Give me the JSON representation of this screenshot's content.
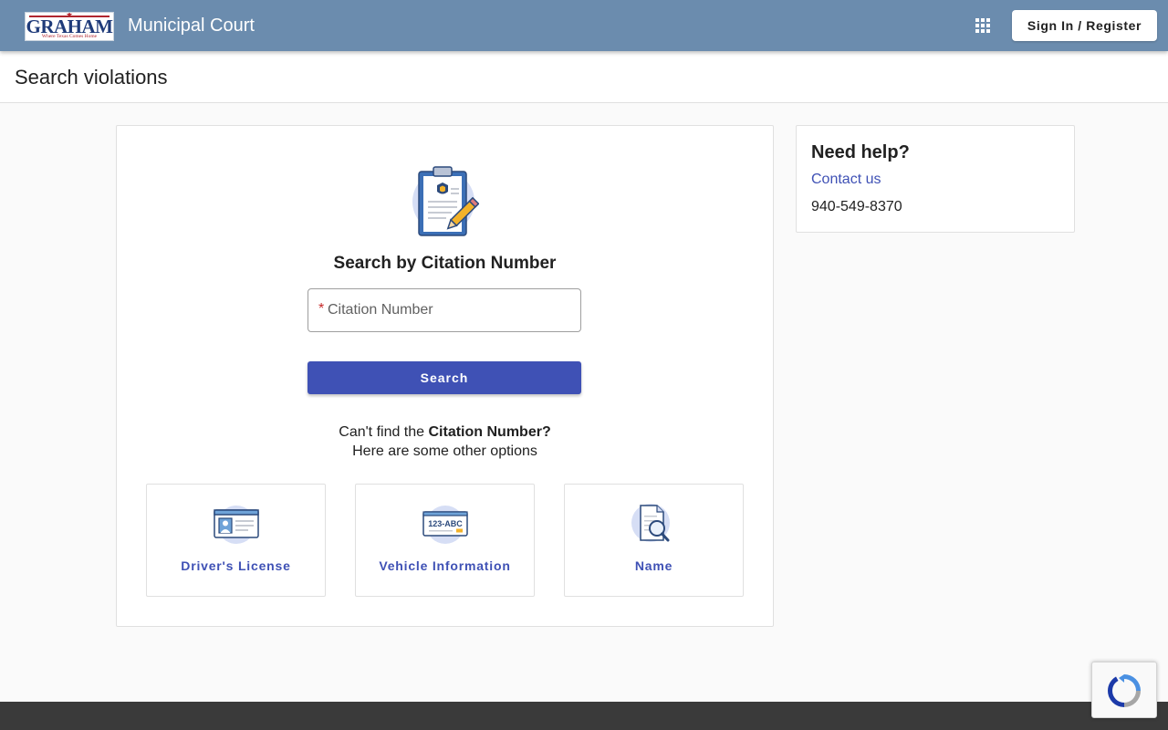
{
  "header": {
    "logo": {
      "name": "GRAHAM",
      "tagline": "Where Texas Comes Home"
    },
    "app_title": "Municipal Court",
    "apps_icon": "apps-grid-icon",
    "signin_label": "Sign In / Register"
  },
  "page": {
    "title": "Search violations"
  },
  "search": {
    "heading": "Search by Citation Number",
    "hero_icon": "clipboard-badge-pencil-icon",
    "field": {
      "required_marker": "*",
      "placeholder": "Citation Number",
      "value": ""
    },
    "button_label": "Search",
    "cant_find_prefix": "Can't find the ",
    "cant_find_bold": "Citation Number?",
    "other_options": "Here are some other options"
  },
  "options": [
    {
      "label": "Driver's License",
      "icon": "id-card-icon"
    },
    {
      "label": "Vehicle Information",
      "icon": "license-plate-icon"
    },
    {
      "label": "Name",
      "icon": "document-search-icon"
    }
  ],
  "help": {
    "title": "Need help?",
    "contact_label": "Contact us",
    "phone": "940-549-8370"
  },
  "recaptcha": {
    "icon": "recaptcha-icon"
  },
  "colors": {
    "appbar": "#6b8cae",
    "primary": "#3f51b5",
    "required": "#c62828",
    "footer": "#3a3a3a"
  }
}
